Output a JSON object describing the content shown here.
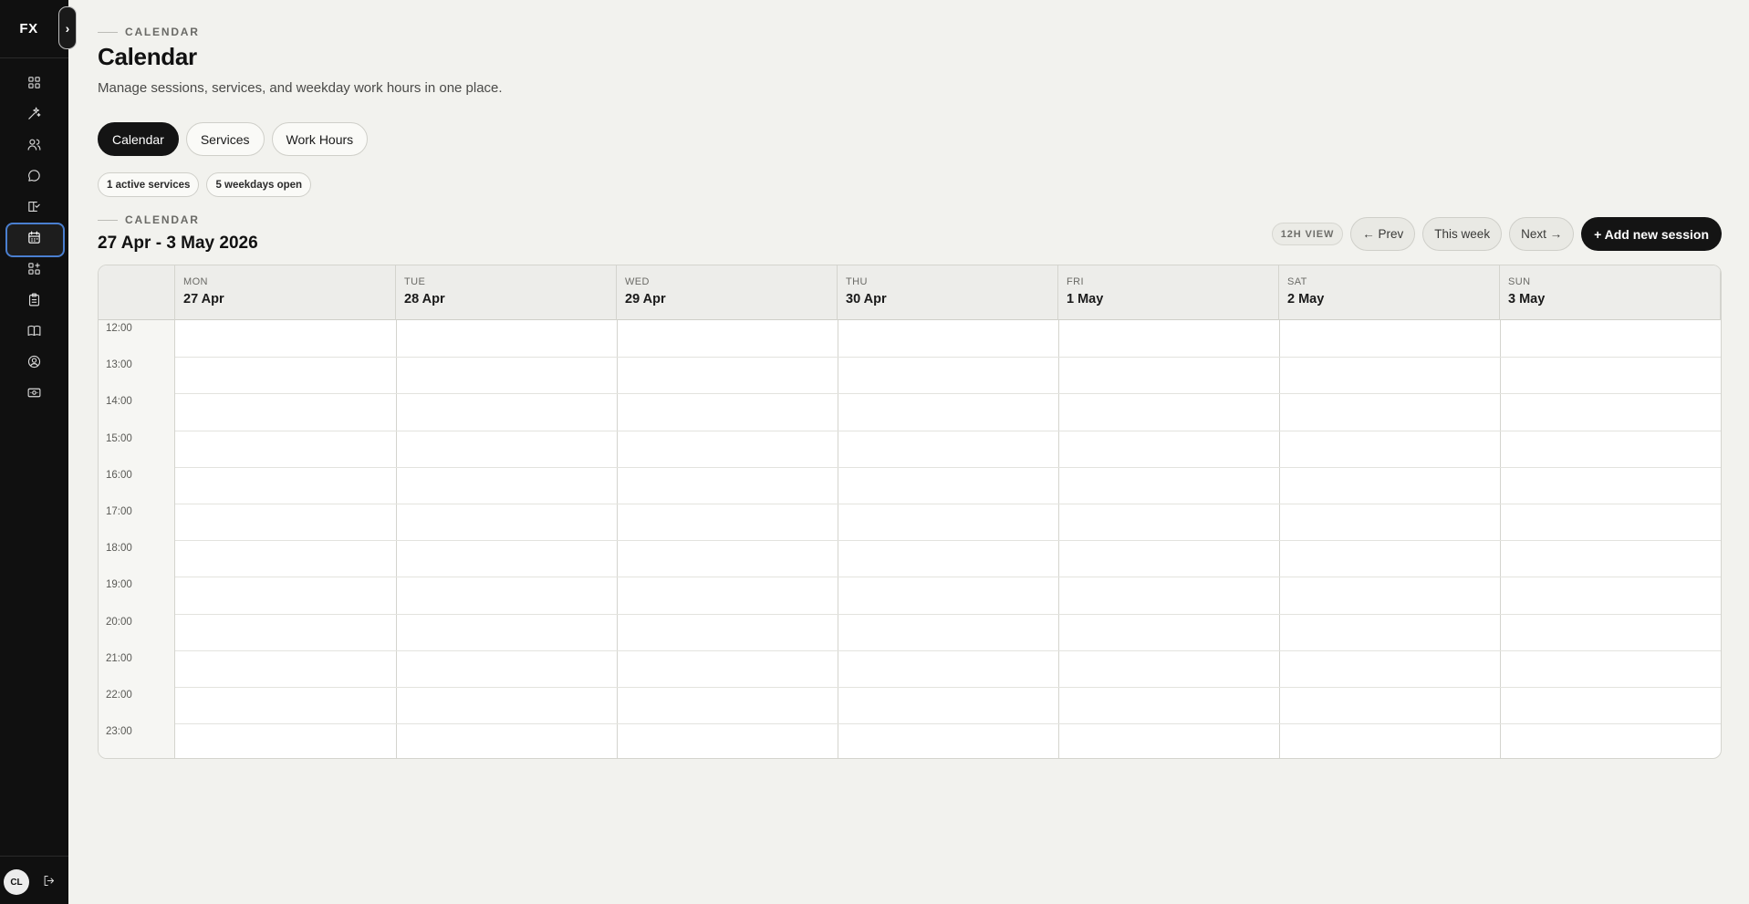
{
  "sidebar": {
    "logo": "FX",
    "toggle_label": "›",
    "nav": [
      {
        "icon": "dashboard-icon",
        "active": false
      },
      {
        "icon": "sparkle-icon",
        "active": false
      },
      {
        "icon": "users-icon",
        "active": false
      },
      {
        "icon": "chat-icon",
        "active": false
      },
      {
        "icon": "checklist-book-icon",
        "active": false
      },
      {
        "icon": "calendar-icon",
        "active": true
      },
      {
        "icon": "widgets-icon",
        "active": false
      },
      {
        "icon": "clipboard-icon",
        "active": false
      },
      {
        "icon": "book-open-icon",
        "active": false
      },
      {
        "icon": "user-circle-icon",
        "active": false
      },
      {
        "icon": "cash-icon",
        "active": false
      }
    ],
    "user_initials": "CL"
  },
  "header": {
    "eyebrow": "CALENDAR",
    "title": "Calendar",
    "subtitle": "Manage sessions, services, and weekday work hours in one place."
  },
  "tabs": [
    {
      "label": "Calendar",
      "active": true
    },
    {
      "label": "Services",
      "active": false
    },
    {
      "label": "Work Hours",
      "active": false
    }
  ],
  "badges": [
    "1 active services",
    "5 weekdays open"
  ],
  "calendar": {
    "eyebrow": "CALENDAR",
    "range": "27 Apr - 3 May 2026",
    "view_label": "12H VIEW",
    "prev_label": "← Prev",
    "this_week_label": "This week",
    "next_label": "Next →",
    "add_label": "+ Add new session",
    "days": [
      {
        "dow": "MON",
        "date": "27 Apr"
      },
      {
        "dow": "TUE",
        "date": "28 Apr"
      },
      {
        "dow": "WED",
        "date": "29 Apr"
      },
      {
        "dow": "THU",
        "date": "30 Apr"
      },
      {
        "dow": "FRI",
        "date": "1 May"
      },
      {
        "dow": "SAT",
        "date": "2 May"
      },
      {
        "dow": "SUN",
        "date": "3 May"
      }
    ],
    "hours": [
      "12:00",
      "13:00",
      "14:00",
      "15:00",
      "16:00",
      "17:00",
      "18:00",
      "19:00",
      "20:00",
      "21:00",
      "22:00",
      "23:00"
    ]
  },
  "colors": {
    "accent": "#141414",
    "active_outline": "#4a7fd0",
    "background": "#f2f2ee",
    "sidebar": "#101010"
  }
}
